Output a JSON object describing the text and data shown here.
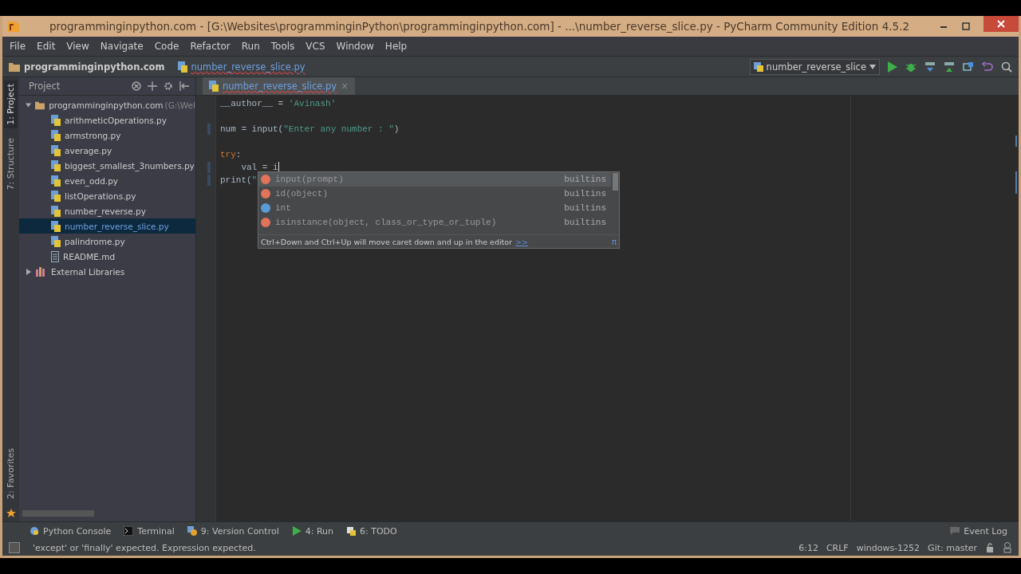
{
  "window": {
    "title": "programminginpython.com - [G:\\Websites\\programminginPython\\programminginpython.com] - ...\\number_reverse_slice.py - PyCharm Community Edition 4.5.2"
  },
  "menu": [
    "File",
    "Edit",
    "View",
    "Navigate",
    "Code",
    "Refactor",
    "Run",
    "Tools",
    "VCS",
    "Window",
    "Help"
  ],
  "breadcrumbs": [
    {
      "label": "programminginpython.com",
      "kind": "folder"
    },
    {
      "label": "number_reverse_slice.py",
      "kind": "python"
    }
  ],
  "run_config": "number_reverse_slice",
  "side_tabs_top": [
    {
      "label": "1: Project",
      "selected": true
    },
    {
      "label": "7: Structure",
      "selected": false
    }
  ],
  "side_tabs_bottom": [
    {
      "label": "2: Favorites",
      "selected": false
    }
  ],
  "project_panel": {
    "title": "Project"
  },
  "tree": [
    {
      "label": "programminginpython.com",
      "hint": "(G:\\Wel",
      "kind": "folder",
      "expanded": true,
      "selected": false,
      "children": [
        {
          "label": "arithmeticOperations.py",
          "kind": "python",
          "selected": false
        },
        {
          "label": "armstrong.py",
          "kind": "python",
          "selected": false
        },
        {
          "label": "average.py",
          "kind": "python",
          "selected": false
        },
        {
          "label": "biggest_smallest_3numbers.py",
          "kind": "python",
          "selected": false
        },
        {
          "label": "even_odd.py",
          "kind": "python",
          "selected": false
        },
        {
          "label": "listOperations.py",
          "kind": "python",
          "selected": false
        },
        {
          "label": "number_reverse.py",
          "kind": "python",
          "selected": false
        },
        {
          "label": "number_reverse_slice.py",
          "kind": "python",
          "selected": true
        },
        {
          "label": "palindrome.py",
          "kind": "python",
          "selected": false
        },
        {
          "label": "README.md",
          "kind": "text",
          "selected": false
        }
      ]
    },
    {
      "label": "External Libraries",
      "kind": "library",
      "expanded": false,
      "selected": false
    }
  ],
  "editor_tab": {
    "label": "number_reverse_slice.py",
    "close": "×"
  },
  "code": [
    {
      "kind": "code",
      "changed": false,
      "caret": false,
      "tokens": [
        {
          "text": "__author__ = ",
          "kind": "plain"
        },
        {
          "text": "'Avinash'",
          "kind": "string"
        }
      ]
    },
    {
      "kind": "blank"
    },
    {
      "kind": "code",
      "changed": true,
      "caret": false,
      "tokens": [
        {
          "text": "num = input(",
          "kind": "plain"
        },
        {
          "text": "\"Enter any number : \"",
          "kind": "string"
        },
        {
          "text": ")",
          "kind": "plain"
        }
      ]
    },
    {
      "kind": "blank"
    },
    {
      "kind": "code",
      "changed": false,
      "caret": false,
      "tokens": [
        {
          "text": "try",
          "kind": "keyword"
        },
        {
          "text": ":",
          "kind": "plain"
        }
      ]
    },
    {
      "kind": "code",
      "changed": true,
      "caret": true,
      "tokens": [
        {
          "text": "    val = i",
          "kind": "plain"
        }
      ]
    },
    {
      "kind": "code",
      "changed": true,
      "caret": false,
      "tokens": [
        {
          "text": "print(",
          "kind": "plain"
        },
        {
          "text": "\"",
          "kind": "string"
        }
      ]
    }
  ],
  "completion": {
    "items": [
      {
        "kind": "function",
        "name": "input",
        "args": "(prompt)",
        "source": "builtins",
        "selected": true
      },
      {
        "kind": "function",
        "name": "id",
        "args": "(object)",
        "source": "builtins",
        "selected": false
      },
      {
        "kind": "class",
        "name": "int",
        "source": "builtins",
        "selected": false
      },
      {
        "kind": "function",
        "name": "isinstance",
        "args": "(object, class_or_type_or_tuple)",
        "source": "builtins",
        "selected": false
      }
    ],
    "hint": "Ctrl+Down and Ctrl+Up will move caret down and up in the editor",
    "link": ">>",
    "pi": "π"
  },
  "tool_windows": [
    {
      "label": "Python Console",
      "kind": "console"
    },
    {
      "label": "Terminal",
      "kind": "terminal"
    },
    {
      "label": "9: Version Control",
      "kind": "vcs"
    },
    {
      "label": "4: Run",
      "kind": "run"
    },
    {
      "label": "6: TODO",
      "kind": "todo"
    }
  ],
  "event_log": "Event Log",
  "status": {
    "message": "'except' or 'finally' expected. Expression expected.",
    "position": "6:12",
    "line_sep": "CRLF",
    "encoding": "windows-1252",
    "branch": "Git: master"
  }
}
